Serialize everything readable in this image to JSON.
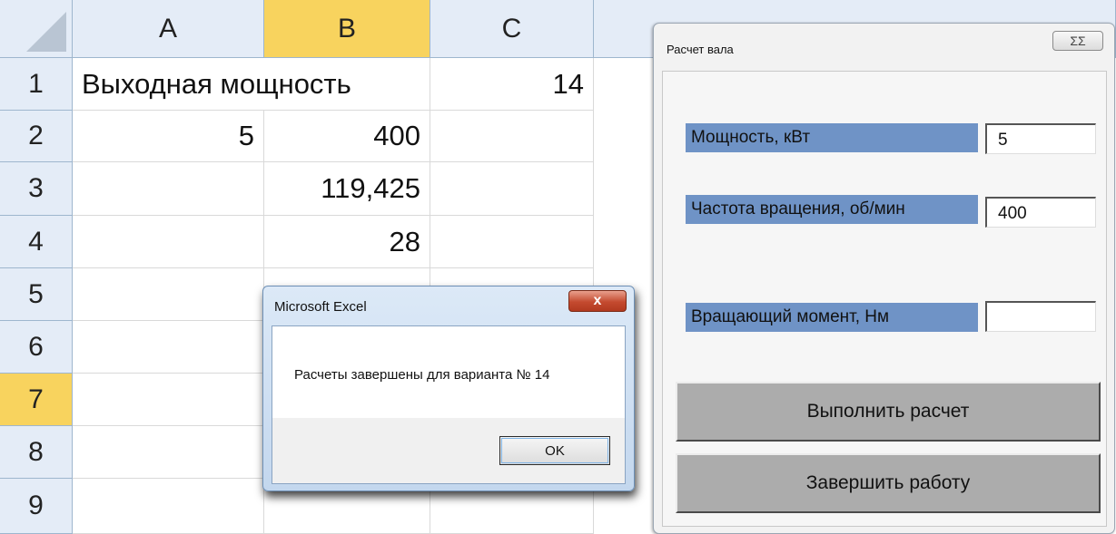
{
  "sheet": {
    "columns": [
      "A",
      "B",
      "C"
    ],
    "rows": [
      "1",
      "2",
      "3",
      "4",
      "5",
      "6",
      "7",
      "8",
      "9"
    ],
    "cells": {
      "A1": "Выходная мощность",
      "C1": "14",
      "A2": "5",
      "B2": "400",
      "B3": "119,425",
      "B4": "28"
    },
    "selected_column": "B",
    "selected_row": "7"
  },
  "message_box": {
    "title": "Microsoft Excel",
    "close_glyph": "x",
    "text": "Расчеты завершены для варианта № 14",
    "ok_label": "OK"
  },
  "form": {
    "title": "Расчет вала",
    "close_glyph": "ΣΣ",
    "power_label": "Мощность, кВт",
    "power_value": "5",
    "speed_label": "Частота вращения, об/мин",
    "speed_value": "400",
    "torque_label": "Вращающий момент, Нм",
    "torque_value": "",
    "calculate_button": "Выполнить расчет",
    "finish_button": "Завершить работу"
  },
  "colors": {
    "selected_header": "#f8d35e",
    "label_background": "#6f93c6",
    "button_background": "#acacac",
    "header_background": "#e4ecf7"
  }
}
